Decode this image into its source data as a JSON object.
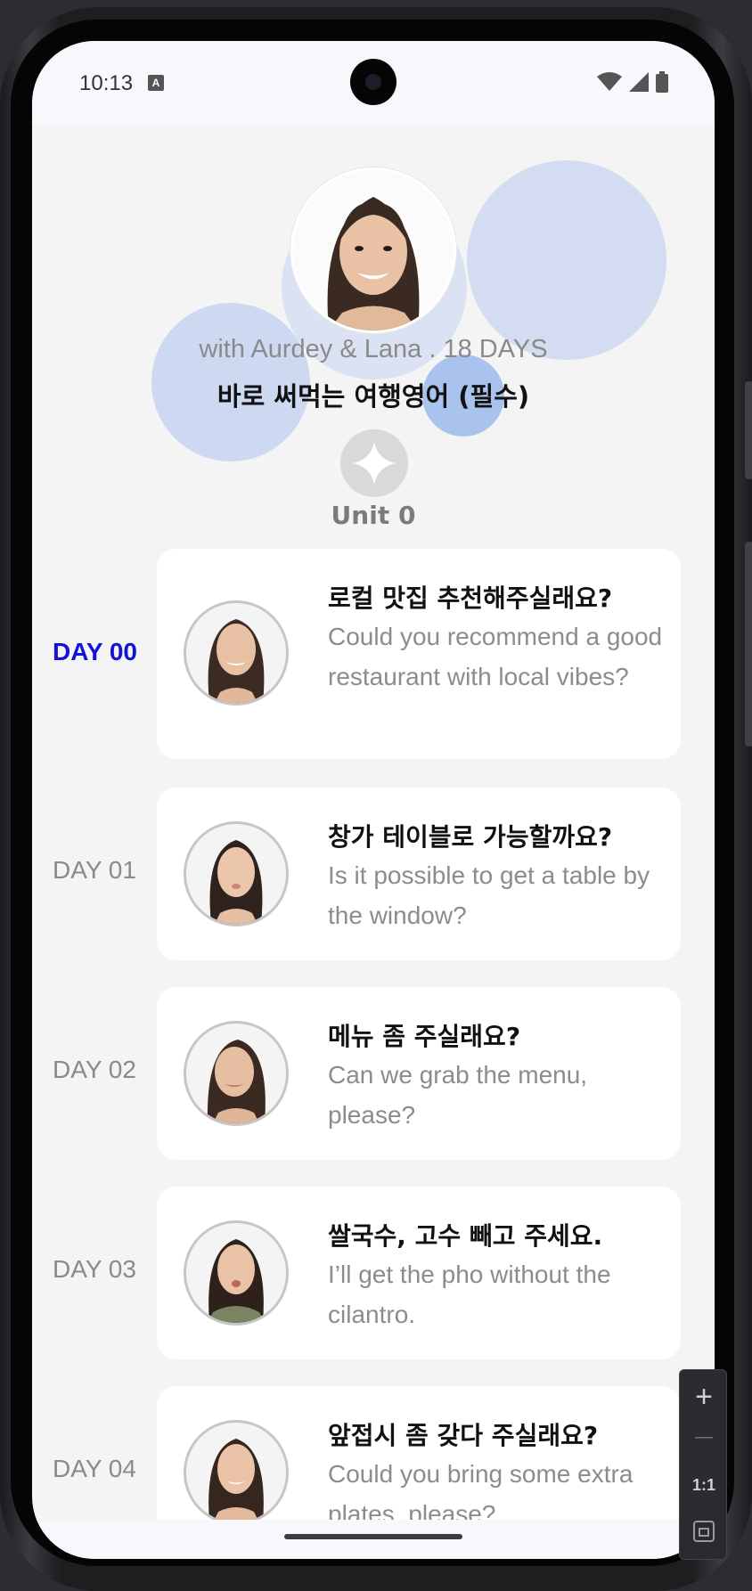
{
  "status_bar": {
    "time": "10:13",
    "badge": "A"
  },
  "header": {
    "subtitle": "with Aurdey & Lana . 18 DAYS",
    "title": "바로 써먹는 여행영어 (필수)"
  },
  "unit": {
    "label": "Unit 0",
    "icon": "sparkle-icon"
  },
  "lessons": [
    {
      "day": "DAY 00",
      "korean": "로컬 맛집 추천해주실래요?",
      "english": "Could you recommend a good restaurant with local vibes?",
      "active": true
    },
    {
      "day": "DAY 01",
      "korean": "창가 테이블로 가능할까요?",
      "english": "Is it possible to get a table by the window?",
      "active": false
    },
    {
      "day": "DAY 02",
      "korean": "메뉴 좀 주실래요?",
      "english": "Can we grab the menu, please?",
      "active": false
    },
    {
      "day": "DAY 03",
      "korean": "쌀국수, 고수 빼고 주세요.",
      "english": "I’ll get the pho without the cilantro.",
      "active": false
    },
    {
      "day": "DAY 04",
      "korean": "앞접시 좀 갖다 주실래요?",
      "english": "Could you bring some extra plates, please?",
      "active": false
    }
  ],
  "zoom_controls": {
    "zoom_in": "+",
    "zoom_out": "—",
    "actual_size": "1:1"
  },
  "colors": {
    "active_day": "#1212d8",
    "blob": "#b9cbee"
  }
}
